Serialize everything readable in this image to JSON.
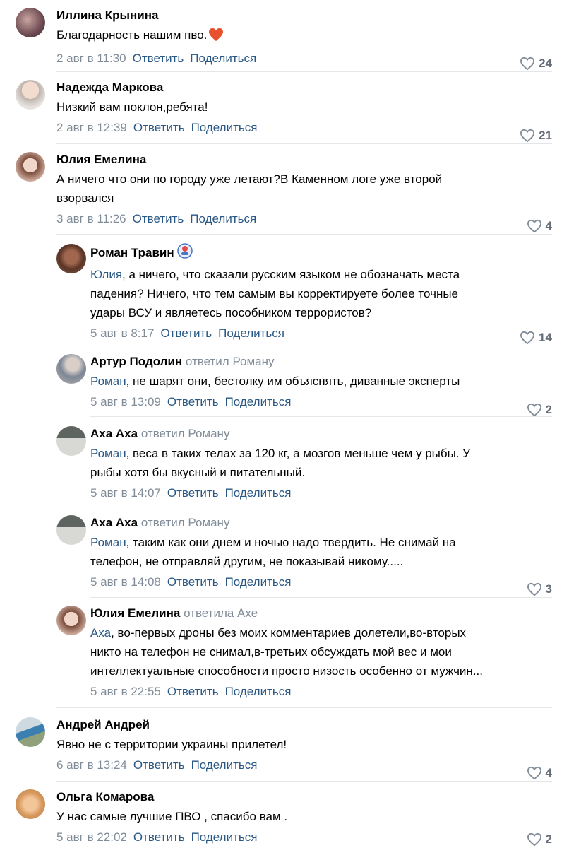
{
  "comments": [
    {
      "author": "Иллина Крынина",
      "replied": "",
      "mention": "",
      "text": "Благодарность нашим пво.",
      "date": "2 авг в 11:30",
      "likes": "24"
    },
    {
      "author": "Надежда Маркова",
      "replied": "",
      "mention": "",
      "text": "Низкий вам поклон,ребята!",
      "date": "2 авг в 12:39",
      "likes": "21"
    },
    {
      "author": "Юлия Емелина",
      "replied": "",
      "mention": "",
      "text": "А ничего что они по городу уже летают?В Каменном логе уже второй\nвзорвался",
      "date": "3 авг в 11:26",
      "likes": "4"
    },
    {
      "author": "Роман Травин",
      "replied": "",
      "mention": "Юлия",
      "text": ", а ничего, что сказали русским языком не обозначать места\nпадения? Ничего, что тем самым вы корректируете более точные\nудары ВСУ и являетесь пособником террористов?",
      "date": "5 авг в 8:17",
      "likes": "14"
    },
    {
      "author": "Артур Подолин",
      "replied": "ответил Роману",
      "mention": "Роман",
      "text": ", не шарят они, бестолку им объяснять, диванные эксперты",
      "date": "5 авг в 13:09",
      "likes": "2"
    },
    {
      "author": "Аха Аха",
      "replied": "ответил Роману",
      "mention": "Роман",
      "text": ", веса в таких телах за 120 кг, а мозгов меньше чем у рыбы. У\nрыбы хотя бы вкусный и питательный.",
      "date": "5 авг в 14:07",
      "likes": ""
    },
    {
      "author": "Аха Аха",
      "replied": "ответил Роману",
      "mention": "Роман",
      "text": ", таким как они днем и ночью надо твердить. Не снимай на\nтелефон, не отправляй другим, не показывай никому.....",
      "date": "5 авг в 14:08",
      "likes": "3"
    },
    {
      "author": "Юлия Емелина",
      "replied": "ответила Ахе",
      "mention": "Аха",
      "text": ", во-первых дроны без моих комментариев долетели,во-вторых\nникто на телефон не снимал,в-третьих обсуждать мой вес и мои\nинтеллектуальные способности просто низость особенно от мужчин...",
      "date": "5 авг в 22:55",
      "likes": ""
    },
    {
      "author": "Андрей Андрей",
      "replied": "",
      "mention": "",
      "text": "Явно не с территории украины прилетел!",
      "date": "6 авг в 13:24",
      "likes": "4"
    },
    {
      "author": "Ольга Комарова",
      "replied": "",
      "mention": "",
      "text": "У нас самые лучшие ПВО , спасибо вам .",
      "date": "5 авг в 22:02",
      "likes": "2"
    }
  ],
  "actions": {
    "reply": "Ответить",
    "share": "Поделиться"
  },
  "colors": {
    "link": "#2a5885",
    "secondary": "#818c99",
    "divider": "#e4e6ea",
    "heart_emoji": "#e8512e"
  },
  "icons": {
    "like": "heart-outline-icon",
    "emoji_in_text": "orange-heart-emoji",
    "author_badge": "esteem-badge-icon"
  }
}
